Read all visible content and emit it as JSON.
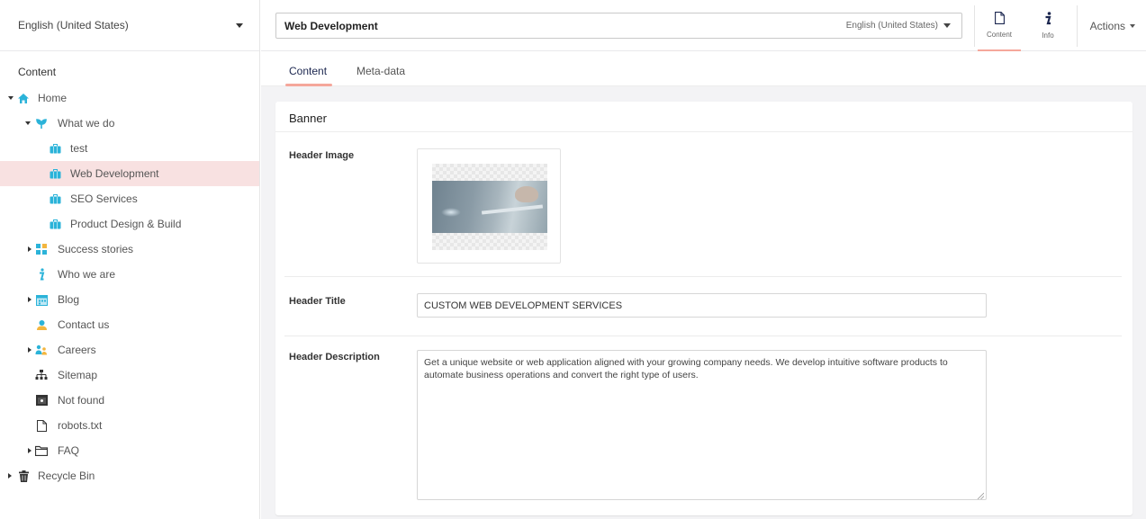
{
  "sidebar": {
    "language": "English (United States)",
    "section_title": "Content",
    "tree": [
      {
        "label": "Home",
        "icon": "home-icon"
      },
      {
        "label": "What we do",
        "icon": "plant-icon"
      },
      {
        "label": "test",
        "icon": "briefcase-icon"
      },
      {
        "label": "Web Development",
        "icon": "briefcase-icon"
      },
      {
        "label": "SEO Services",
        "icon": "briefcase-icon"
      },
      {
        "label": "Product Design & Build",
        "icon": "briefcase-icon"
      },
      {
        "label": "Success stories",
        "icon": "grid-icon"
      },
      {
        "label": "Who we are",
        "icon": "info-icon"
      },
      {
        "label": "Blog",
        "icon": "calendar-icon"
      },
      {
        "label": "Contact us",
        "icon": "contact-icon"
      },
      {
        "label": "Careers",
        "icon": "people-icon"
      },
      {
        "label": "Sitemap",
        "icon": "sitemap-icon"
      },
      {
        "label": "Not found",
        "icon": "window-icon"
      },
      {
        "label": "robots.txt",
        "icon": "document-icon"
      },
      {
        "label": "FAQ",
        "icon": "folder-icon"
      },
      {
        "label": "Recycle Bin",
        "icon": "trash-icon"
      }
    ]
  },
  "header": {
    "node_name": "Web Development",
    "language": "English (United States)",
    "apps": [
      {
        "label": "Content",
        "icon": "document-icon"
      },
      {
        "label": "Info",
        "icon": "info-icon"
      }
    ],
    "actions_label": "Actions"
  },
  "tabs": [
    {
      "label": "Content"
    },
    {
      "label": "Meta-data"
    }
  ],
  "panel": {
    "title": "Banner",
    "properties": {
      "header_image_label": "Header Image",
      "header_title_label": "Header Title",
      "header_title_value": "CUSTOM WEB DEVELOPMENT SERVICES",
      "header_description_label": "Header Description",
      "header_description_value": "Get a unique website or web application aligned with your growing company needs. We develop intuitive software products to automate business operations and convert the right type of users."
    }
  },
  "colors": {
    "accent": "#f5a79b",
    "selected_row": "#f8e1e1",
    "icon_blue": "#2bb3d9",
    "nav_dark": "#1b264f"
  }
}
